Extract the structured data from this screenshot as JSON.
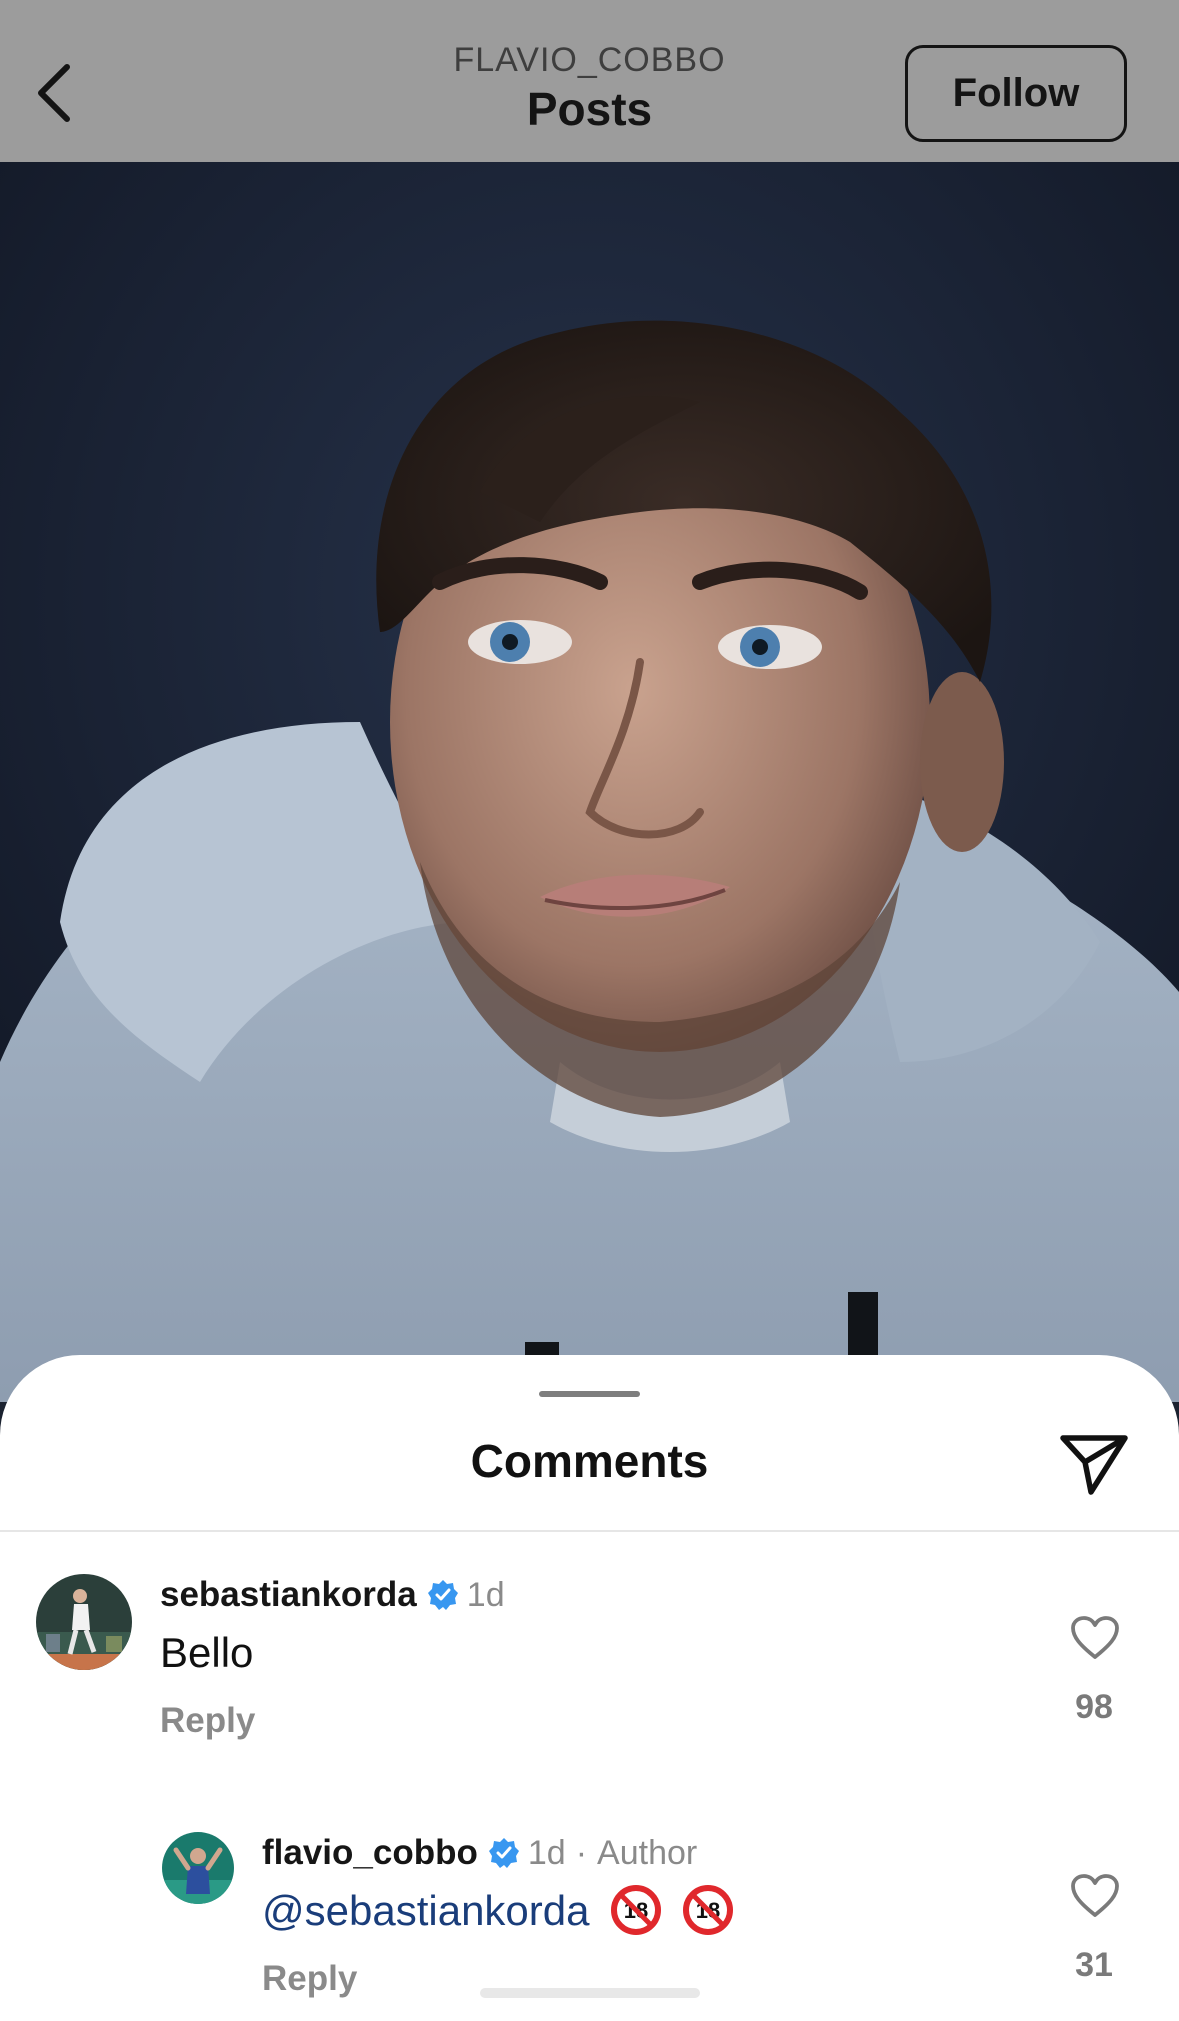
{
  "header": {
    "username": "FLAVIO_COBBO",
    "title": "Posts",
    "follow_label": "Follow"
  },
  "post": {
    "image": "portrait-photo"
  },
  "comments_sheet": {
    "title": "Comments",
    "comments": [
      {
        "username": "sebastiankorda",
        "verified": true,
        "time": "1d",
        "text": "Bello",
        "reply_label": "Reply",
        "likes": "98"
      },
      {
        "username": "flavio_cobbo",
        "verified": true,
        "time": "1d",
        "separator": "·",
        "author_tag": "Author",
        "mention": "@sebastiankorda",
        "emojis": [
          "no-one-under-eighteen",
          "no-one-under-eighteen"
        ],
        "reply_label": "Reply",
        "likes": "31"
      }
    ]
  },
  "colors": {
    "header_bg": "#9c9c9c",
    "verified_blue": "#3897f0",
    "mention_blue": "#1a3d7a",
    "muted_text": "#8a8a8a"
  },
  "icons": {
    "back": "chevron-left-icon",
    "share": "paper-plane-icon",
    "like": "heart-icon",
    "verified": "verified-badge-icon"
  }
}
